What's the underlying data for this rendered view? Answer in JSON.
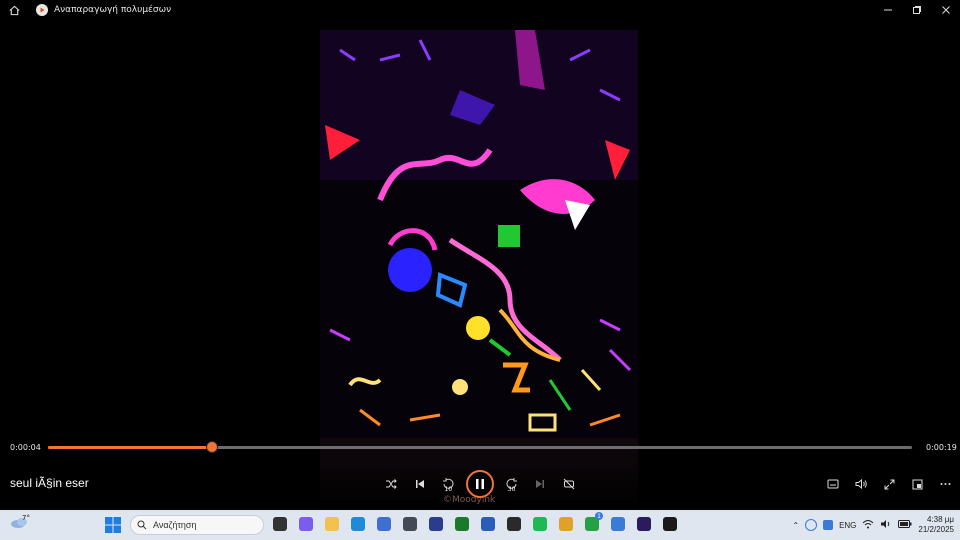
{
  "window": {
    "title": "Αναπαραγωγή πολυμέσων",
    "controls": [
      "minimize-icon",
      "restore-icon",
      "close-icon"
    ]
  },
  "player": {
    "elapsed": "0:00:04",
    "duration": "0:00:19",
    "progress_fraction": 0.19,
    "now_playing": "seul iÃ§in eser",
    "watermark": "©Moodyink",
    "skip_back_seconds": "10",
    "skip_forward_seconds": "30",
    "accent_color": "#f3733a"
  },
  "taskbar": {
    "weather_temp": "7°",
    "search_placeholder": "Αναζήτηση",
    "apps": [
      {
        "name": "task-view",
        "color": "#333333"
      },
      {
        "name": "copilot",
        "color": "#7b5cf0"
      },
      {
        "name": "file-explorer",
        "color": "#f2c14e"
      },
      {
        "name": "edge",
        "color": "#1f8ad6"
      },
      {
        "name": "store",
        "color": "#3f6fd1"
      },
      {
        "name": "cube-app",
        "color": "#444a55"
      },
      {
        "name": "affinity",
        "color": "#2b3c8c"
      },
      {
        "name": "xbox",
        "color": "#1a7a2a"
      },
      {
        "name": "word",
        "color": "#2b5db8"
      },
      {
        "name": "media-app",
        "color": "#2a2a2a"
      },
      {
        "name": "spotify",
        "color": "#1db954"
      },
      {
        "name": "chrome-like",
        "color": "#e0a12a"
      },
      {
        "name": "whatsapp",
        "color": "#25a045"
      },
      {
        "name": "notes",
        "color": "#3a7bd5"
      },
      {
        "name": "premiere",
        "color": "#2a1a5e"
      },
      {
        "name": "media-player",
        "color": "#1a1a1a"
      }
    ],
    "whatsapp_badge": "1",
    "language": "ENG",
    "time": "4:38 μμ",
    "date": "21/2/2025"
  }
}
